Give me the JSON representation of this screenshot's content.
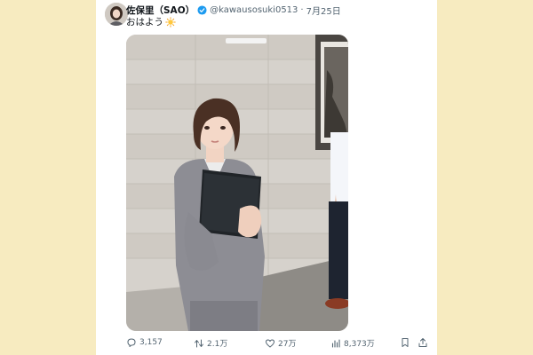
{
  "tweet": {
    "display_name": "佐保里（SAO）",
    "handle": "@kawausosuki0513",
    "separator": "·",
    "date": "7月25日",
    "text": "おはよう",
    "emoji": "sun-emoji",
    "verified": true
  },
  "media": {
    "type": "photo"
  },
  "actions": {
    "replies": "3,157",
    "reposts": "2.1万",
    "likes": "27万",
    "views": "8,373万"
  },
  "colors": {
    "page_background": "#f7ebc0",
    "card_background": "#ffffff",
    "verified_blue": "#1d9bf0",
    "secondary_text": "#536471",
    "primary_text": "#0f1419"
  },
  "icons": [
    "verified-icon",
    "reply-icon",
    "repost-icon",
    "like-icon",
    "views-icon",
    "bookmark-icon",
    "share-icon"
  ]
}
